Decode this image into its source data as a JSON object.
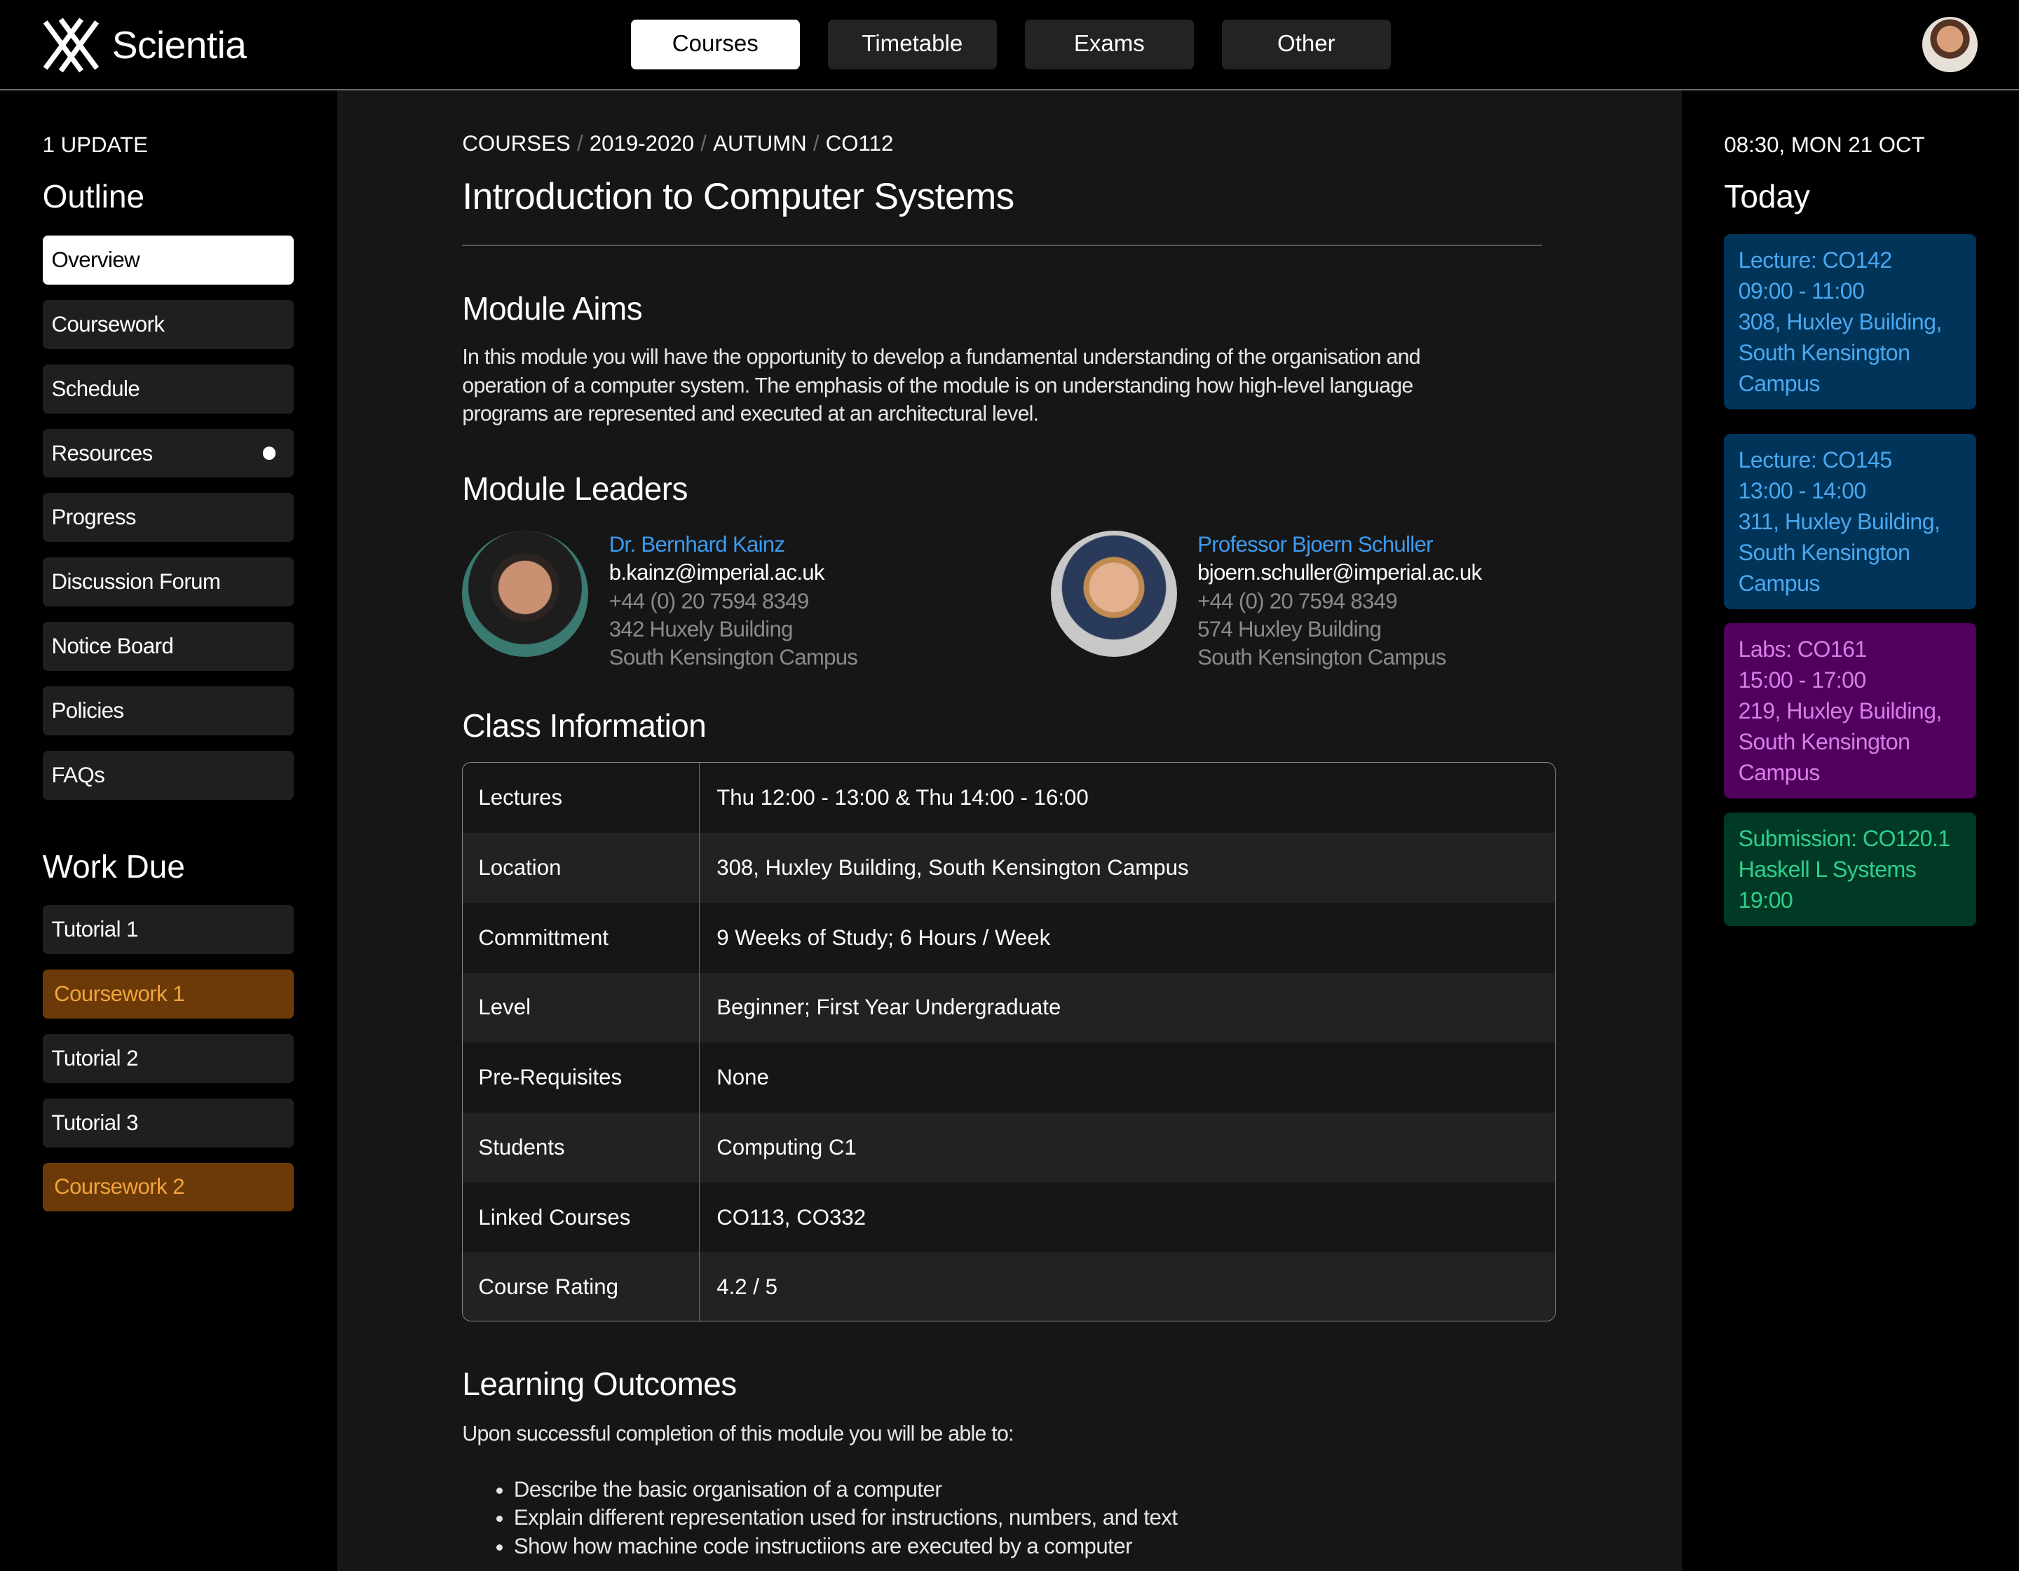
{
  "header": {
    "brand": "Scientia",
    "tabs": [
      {
        "label": "Courses",
        "active": true
      },
      {
        "label": "Timetable",
        "active": false
      },
      {
        "label": "Exams",
        "active": false
      },
      {
        "label": "Other",
        "active": false
      }
    ]
  },
  "sidebar": {
    "updates": "1 UPDATE",
    "outline_title": "Outline",
    "outline": [
      "Overview",
      "Coursework",
      "Schedule",
      "Resources",
      "Progress",
      "Discussion Forum",
      "Notice Board",
      "Policies",
      "FAQs"
    ],
    "work_due_title": "Work Due",
    "work_due": [
      {
        "label": "Tutorial 1",
        "highlight": false
      },
      {
        "label": "Coursework 1",
        "highlight": true
      },
      {
        "label": "Tutorial 2",
        "highlight": false
      },
      {
        "label": "Tutorial 3",
        "highlight": false
      },
      {
        "label": "Coursework 2",
        "highlight": true
      }
    ]
  },
  "main": {
    "breadcrumb": [
      "COURSES",
      "2019-2020",
      "AUTUMN",
      "CO112"
    ],
    "breadcrumb_sep": "/",
    "title": "Introduction to Computer Systems",
    "aims_title": "Module Aims",
    "aims_text": "In this module you will have the opportunity to develop a fundamental understanding of the organisation and operation of a computer system. The emphasis of the module is on understanding how high-level language programs are represented and executed at an architectural level.",
    "leaders_title": "Module Leaders",
    "leaders": [
      {
        "name": "Dr. Bernhard Kainz",
        "email": "b.kainz@imperial.ac.uk",
        "phone": "+44 (0) 20 7594 8349",
        "room": "342 Huxely Building",
        "campus": "South Kensington Campus"
      },
      {
        "name": "Professor Bjoern Schuller",
        "email": "bjoern.schuller@imperial.ac.uk",
        "phone": "+44 (0) 20 7594 8349",
        "room": "574 Huxley Building",
        "campus": "South Kensington Campus"
      }
    ],
    "class_title": "Class Information",
    "class_info": [
      [
        "Lectures",
        "Thu 12:00 - 13:00 & Thu 14:00 - 16:00"
      ],
      [
        "Location",
        "308, Huxley Building, South Kensington Campus"
      ],
      [
        "Committment",
        "9 Weeks of Study; 6 Hours / Week"
      ],
      [
        "Level",
        "Beginner; First Year Undergraduate"
      ],
      [
        "Pre-Requisites",
        "None"
      ],
      [
        "Students",
        "Computing C1"
      ],
      [
        "Linked Courses",
        "CO113, CO332"
      ],
      [
        "Course Rating",
        "4.2 / 5"
      ]
    ],
    "outcomes_title": "Learning Outcomes",
    "outcomes_intro": "Upon successful completion of this module you will be able to:",
    "outcomes": [
      "Describe the basic organisation of a computer",
      "Explain different representation used for instructions, numbers, and text",
      "Show how machine code instructiions are executed by a computer"
    ]
  },
  "today": {
    "datetime": "08:30, MON 21 OCT",
    "title": "Today",
    "events": [
      {
        "lines": [
          "Lecture: CO142",
          "09:00 - 11:00",
          "308, Huxley Building,",
          "South Kensington",
          "Campus"
        ],
        "bg": "#003459",
        "fg": "#4aa8f0"
      },
      {
        "lines": [
          "Lecture: CO145",
          "13:00 - 14:00",
          "311, Huxley Building,",
          "South Kensington",
          "Campus"
        ],
        "bg": "#003459",
        "fg": "#4aa8f0"
      },
      {
        "lines": [
          "Labs: CO161",
          "15:00 - 17:00",
          "219, Huxley Building,",
          "South Kensington",
          "Campus"
        ],
        "bg": "#52005e",
        "fg": "#d97ee8"
      },
      {
        "lines": [
          "Submission: CO120.1",
          "Haskell L Systems",
          "19:00"
        ],
        "bg": "#003a26",
        "fg": "#2ed08a"
      }
    ]
  },
  "colors": {
    "warn_bg": "#6b3a08",
    "warn_fg": "#f2a33a",
    "link": "#3d9bf0"
  }
}
